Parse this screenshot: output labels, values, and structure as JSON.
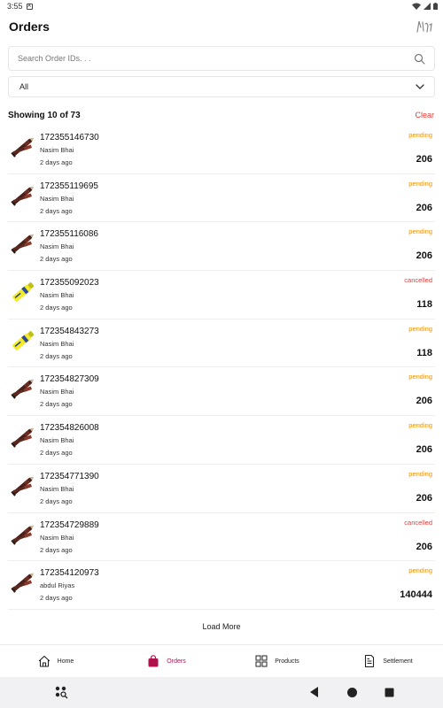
{
  "status_bar": {
    "time": "3:55",
    "sim_label": "A"
  },
  "header": {
    "title": "Orders"
  },
  "search": {
    "placeholder": "Search Order IDs. . ."
  },
  "filter": {
    "selected": "All"
  },
  "results": {
    "count_text": "Showing 10 of 73",
    "clear_label": "Clear"
  },
  "colors": {
    "pending": "#f29100",
    "cancelled": "#e53935",
    "accent": "#b0124e"
  },
  "orders": [
    {
      "id": "172355146730",
      "customer": "Nasim Bhai",
      "time": "2 days ago",
      "status": "pending",
      "amount": "206",
      "product_icon": "pen-icon"
    },
    {
      "id": "172355119695",
      "customer": "Nasim Bhai",
      "time": "2 days ago",
      "status": "pending",
      "amount": "206",
      "product_icon": "pen-icon"
    },
    {
      "id": "172355116086",
      "customer": "Nasim Bhai",
      "time": "2 days ago",
      "status": "pending",
      "amount": "206",
      "product_icon": "pen-icon"
    },
    {
      "id": "172355092023",
      "customer": "Nasim Bhai",
      "time": "2 days ago",
      "status": "cancelled",
      "amount": "118",
      "product_icon": "highlighter-icon"
    },
    {
      "id": "172354843273",
      "customer": "Nasim Bhai",
      "time": "2 days ago",
      "status": "pending",
      "amount": "118",
      "product_icon": "highlighter-icon"
    },
    {
      "id": "172354827309",
      "customer": "Nasim Bhai",
      "time": "2 days ago",
      "status": "pending",
      "amount": "206",
      "product_icon": "pen-icon"
    },
    {
      "id": "172354826008",
      "customer": "Nasim Bhai",
      "time": "2 days ago",
      "status": "pending",
      "amount": "206",
      "product_icon": "pen-icon"
    },
    {
      "id": "172354771390",
      "customer": "Nasim Bhai",
      "time": "2 days ago",
      "status": "pending",
      "amount": "206",
      "product_icon": "pen-icon"
    },
    {
      "id": "172354729889",
      "customer": "Nasim Bhai",
      "time": "2 days ago",
      "status": "cancelled",
      "amount": "206",
      "product_icon": "pen-icon"
    },
    {
      "id": "172354120973",
      "customer": "abdul Riyas",
      "time": "2 days ago",
      "status": "pending",
      "amount": "140444",
      "product_icon": "pen-icon"
    }
  ],
  "load_more": {
    "label": "Load More"
  },
  "bottom_nav": {
    "items": [
      {
        "label": "Home",
        "icon": "home-icon",
        "active": false
      },
      {
        "label": "Orders",
        "icon": "shopping-bag-icon",
        "active": true
      },
      {
        "label": "Products",
        "icon": "grid-icon",
        "active": false
      },
      {
        "label": "Settlement",
        "icon": "document-icon",
        "active": false
      }
    ]
  }
}
